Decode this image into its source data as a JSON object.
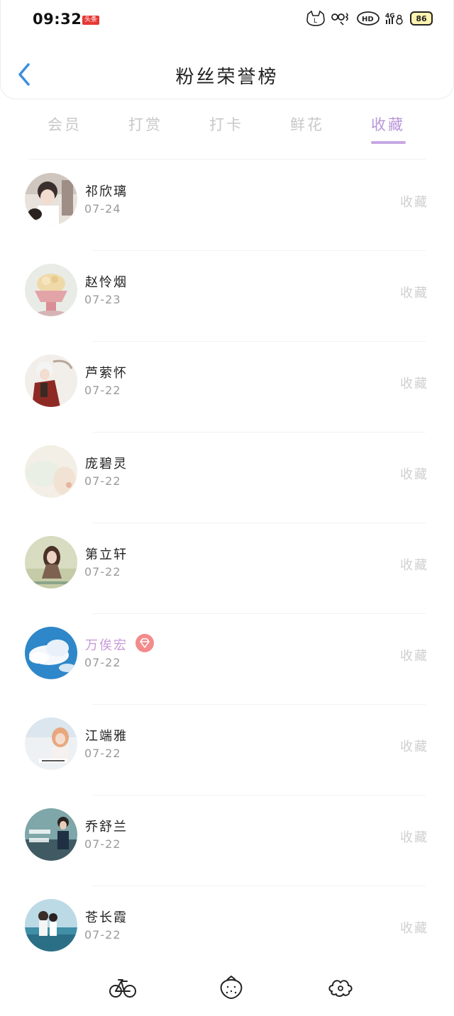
{
  "status_bar": {
    "time": "09:32",
    "badge": "头条",
    "icons": [
      "cat-icon",
      "signal-glyph-icon",
      "hd-icon",
      "4g-signal-icon",
      "battery-icon"
    ],
    "battery": "86"
  },
  "header": {
    "title": "粉丝荣誉榜",
    "back_icon": "chevron-left-icon"
  },
  "tabs": [
    {
      "label": "会员",
      "active": false
    },
    {
      "label": "打赏",
      "active": false
    },
    {
      "label": "打卡",
      "active": false
    },
    {
      "label": "鲜花",
      "active": false
    },
    {
      "label": "收藏",
      "active": true
    }
  ],
  "colors": {
    "accent": "#b997d8",
    "underline": "#c6a8e3",
    "vip_badge": "#f48b8b",
    "back_arrow": "#3b8fe0"
  },
  "fans": [
    {
      "name": "祁欣璃",
      "date": "07-24",
      "status": "收藏",
      "vip": false
    },
    {
      "name": "赵怜烟",
      "date": "07-23",
      "status": "收藏",
      "vip": false
    },
    {
      "name": "芦萦怀",
      "date": "07-22",
      "status": "收藏",
      "vip": false
    },
    {
      "name": "庞碧灵",
      "date": "07-22",
      "status": "收藏",
      "vip": false
    },
    {
      "name": "第立轩",
      "date": "07-22",
      "status": "收藏",
      "vip": false
    },
    {
      "name": "万俟宏",
      "date": "07-22",
      "status": "收藏",
      "vip": true
    },
    {
      "name": "江端雅",
      "date": "07-22",
      "status": "收藏",
      "vip": false
    },
    {
      "name": "乔舒兰",
      "date": "07-22",
      "status": "收藏",
      "vip": false
    },
    {
      "name": "苍长霞",
      "date": "07-22",
      "status": "收藏",
      "vip": false
    }
  ],
  "bottom_nav": [
    {
      "icon": "bicycle-icon"
    },
    {
      "icon": "strawberry-icon"
    },
    {
      "icon": "flower-cloud-icon"
    }
  ]
}
